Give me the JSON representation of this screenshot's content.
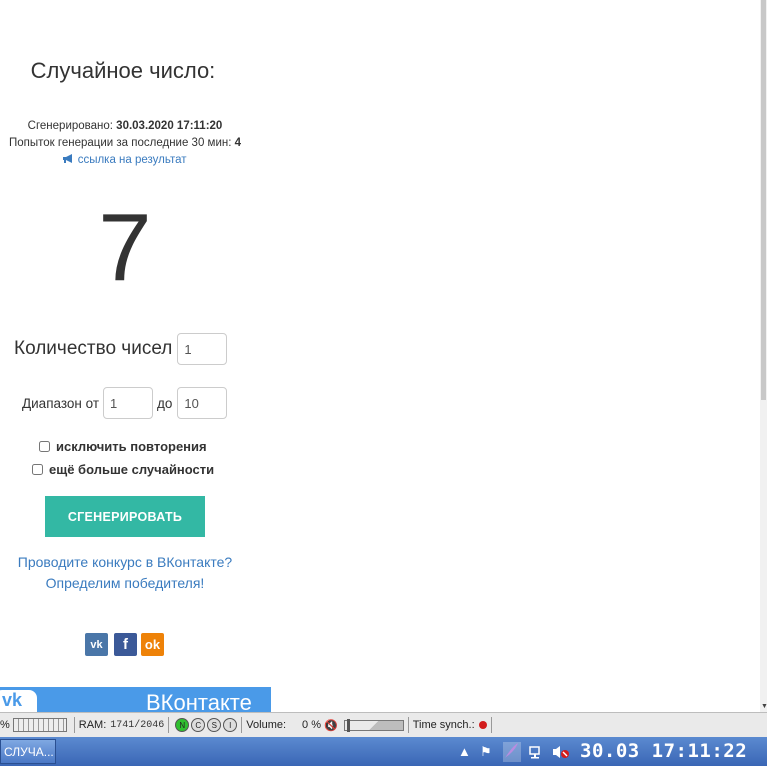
{
  "header": {
    "title": "Случайное число:"
  },
  "meta": {
    "generated_label": "Сгенерировано: ",
    "generated_value": "30.03.2020 17:11:20",
    "attempts_label": "Попыток генерации за последние 30 мин: ",
    "attempts_value": "4",
    "result_link": "ссылка на результат",
    "result_link_icon": "megaphone-icon"
  },
  "result": {
    "number": "7"
  },
  "form": {
    "count_label": "Количество чисел",
    "count_value": "1",
    "range_label": "Диапазон от",
    "range_from": "1",
    "range_to_label": "до",
    "range_to": "10",
    "exclude_repeats": "исключить повторения",
    "more_random": "ещё больше случайности",
    "generate_button": "СГЕНЕРИРОВАТЬ",
    "accent_color": "#33b8a4"
  },
  "promo": {
    "line1": "Проводите конкурс в ВКонтакте?",
    "line2": "Определим победителя!"
  },
  "social": {
    "vk": "vk",
    "fb": "f",
    "ok": "ok"
  },
  "banner": {
    "logo": "vk",
    "text": "ВКонтакте"
  },
  "monitor": {
    "cpu": "%",
    "ram_label": "RAM:",
    "ram_value": "1741/2046",
    "indicators": [
      "N",
      "C",
      "S",
      "I"
    ],
    "volume_label": "Volume:",
    "volume_value": "0 %",
    "time_sync_label": "Time synch.:"
  },
  "taskbar": {
    "task": "СЛУЧА...",
    "clock": "30.03 17:11:22"
  }
}
